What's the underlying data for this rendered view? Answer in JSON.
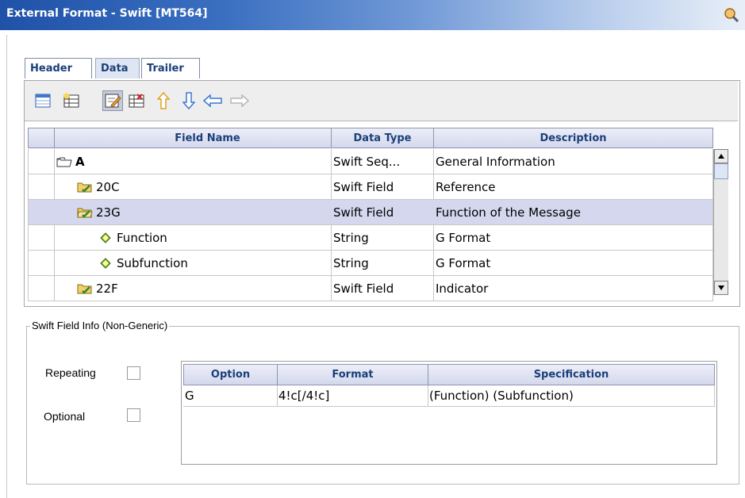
{
  "window": {
    "title": "External Format - Swift [MT564]"
  },
  "tabs": [
    {
      "label": "Header",
      "active": false
    },
    {
      "label": "Data",
      "active": true
    },
    {
      "label": "Trailer",
      "active": false
    }
  ],
  "toolbar": {
    "buttons": [
      {
        "icon": "table-view-icon"
      },
      {
        "icon": "insert-row-icon"
      },
      {
        "icon": "edit-icon",
        "pressed": true
      },
      {
        "icon": "delete-row-icon"
      },
      {
        "icon": "arrow-up-icon"
      },
      {
        "icon": "arrow-down-icon"
      },
      {
        "icon": "arrow-left-icon"
      },
      {
        "icon": "arrow-right-icon",
        "disabled": true
      }
    ]
  },
  "grid": {
    "columns": [
      "Field Name",
      "Data Type",
      "Description"
    ],
    "rows": [
      {
        "name": "A",
        "type": "Swift Seq...",
        "description": "General Information",
        "icon": "folder-open-icon",
        "indent": 0,
        "bold": true,
        "selected": false
      },
      {
        "name": "20C",
        "type": "Swift Field",
        "description": "Reference",
        "icon": "folder-field-icon",
        "indent": 1,
        "bold": false,
        "selected": false
      },
      {
        "name": "23G",
        "type": "Swift Field",
        "description": "Function of the Message",
        "icon": "folder-field-open-icon",
        "indent": 1,
        "bold": false,
        "selected": true
      },
      {
        "name": "Function",
        "type": "String",
        "description": "G Format",
        "icon": "diamond-icon",
        "indent": 2,
        "bold": false,
        "selected": false
      },
      {
        "name": "Subfunction",
        "type": "String",
        "description": "G Format",
        "icon": "diamond-icon",
        "indent": 2,
        "bold": false,
        "selected": false
      },
      {
        "name": "22F",
        "type": "Swift Field",
        "description": "Indicator",
        "icon": "folder-field-icon",
        "indent": 1,
        "bold": false,
        "selected": false
      }
    ]
  },
  "field_info": {
    "group_label": "Swift Field Info (Non-Generic)",
    "repeating_label": "Repeating",
    "repeating_checked": false,
    "optional_label": "Optional",
    "optional_checked": false,
    "columns": [
      "Option",
      "Format",
      "Specification"
    ],
    "rows": [
      {
        "option": "G",
        "format": "4!c[/4!c]",
        "specification": "(Function) (Subfunction)"
      }
    ]
  },
  "colors": {
    "titlebar": "#1f52a8",
    "selected_row": "#d4d7ee",
    "header_text": "#1a3f7a"
  }
}
